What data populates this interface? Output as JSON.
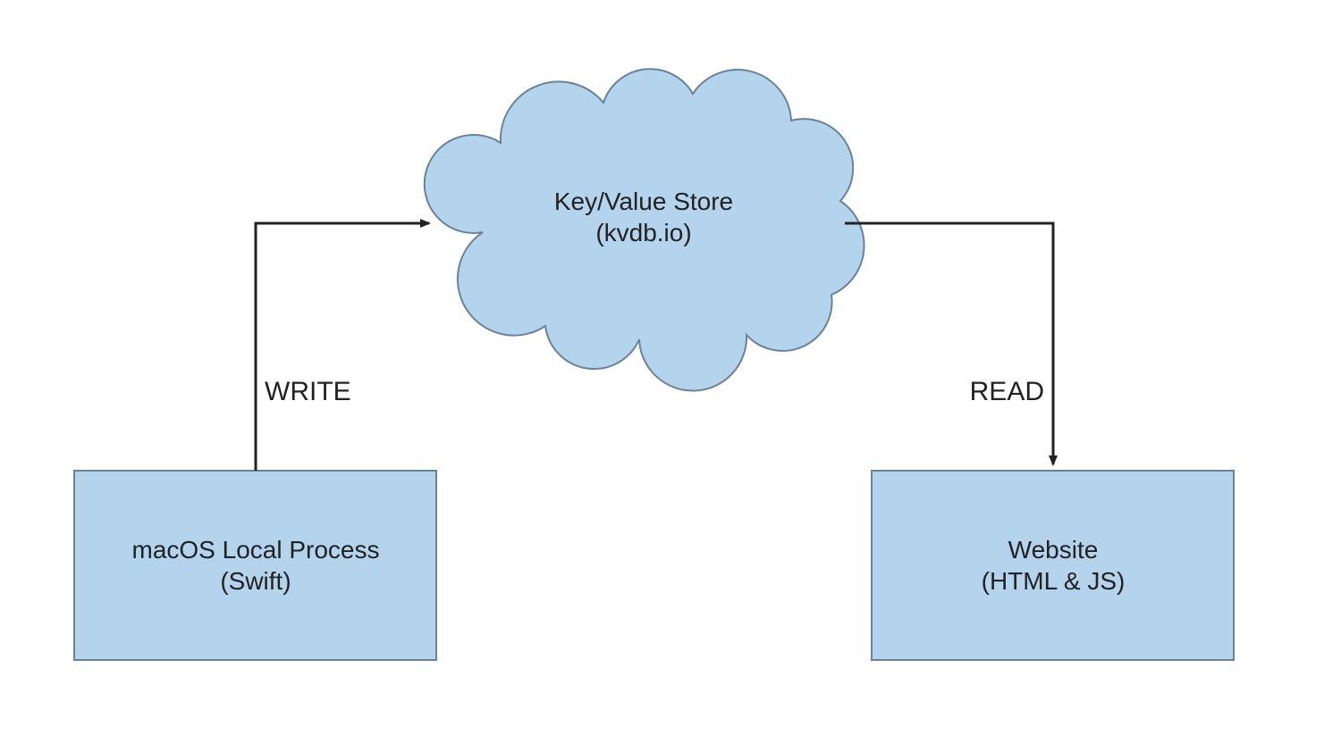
{
  "nodes": {
    "cloud": {
      "line1": "Key/Value Store",
      "line2": "(kvdb.io)"
    },
    "left_box": {
      "line1": "macOS Local Process",
      "line2": "(Swift)"
    },
    "right_box": {
      "line1": "Website",
      "line2": "(HTML & JS)"
    }
  },
  "edges": {
    "write": "WRITE",
    "read": "READ"
  },
  "colors": {
    "fill": "#b4d4ed",
    "stroke": "#6c8298",
    "line": "#222222"
  }
}
